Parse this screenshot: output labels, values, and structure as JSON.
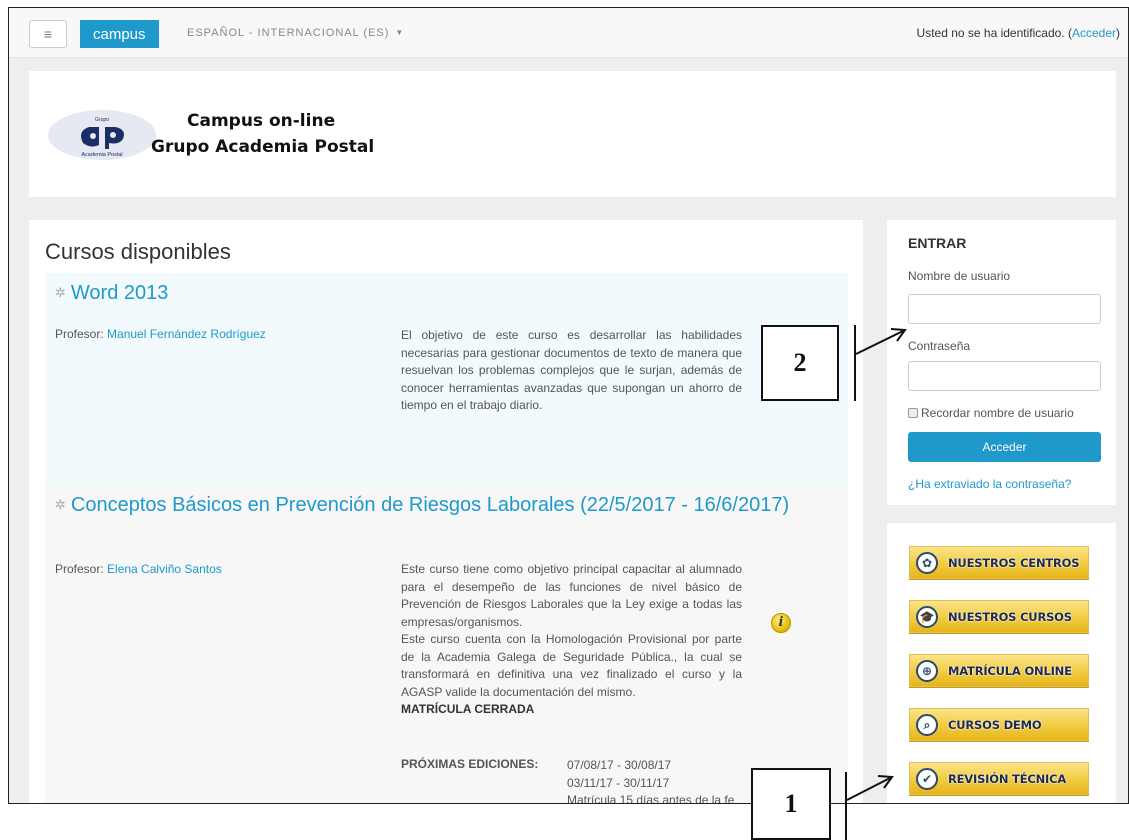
{
  "navbar": {
    "menu_icon": "hamburger-icon",
    "menu_glyph": "≡",
    "brand": "campus",
    "language": "ESPAÑOL - INTERNACIONAL (ES)",
    "login_status_prefix": "Usted no se ha identificado. (",
    "login_link": "Acceder",
    "login_status_suffix": ")"
  },
  "header": {
    "logo_icon": "academia-postal-logo",
    "logo_text_top": "Grupo",
    "logo_text_bottom": "Academia Postal",
    "site_line1": "Campus on-line",
    "site_line2": "Grupo Academia Postal"
  },
  "main": {
    "title": "Cursos disponibles",
    "courses": [
      {
        "title": "Word 2013",
        "teacher_label": "Profesor: ",
        "teacher_name": "Manuel Fernández Rodríguez",
        "summary": "El objetivo de este curso es desarrollar las habilidades necesarias para gestionar documentos de texto de manera que resuelvan los problemas complejos que le surjan, además de conocer herramientas avanzadas que supongan un ahorro de tiempo en el trabajo diario."
      },
      {
        "title": "Conceptos Básicos en Prevención de Riesgos Laborales (22/5/2017 - 16/6/2017)",
        "teacher_label": "Profesor: ",
        "teacher_name": "Elena Calviño Santos",
        "summary_p1": "Este curso tiene como objetivo principal capacitar al alumnado para el desempeño de las funciones de nivel básico de Prevención de Riesgos Laborales que la Ley exige a todas las empresas/organismos.",
        "summary_p2": "Este curso cuenta con la Homologación Provisional por parte de la  Academia Galega de Seguridade Pública., la cual se transformará en definitiva una vez finalizado el curso y la AGASP valide la documentación del mismo.",
        "closed": "MATRÍCULA CERRADA",
        "info_icon": "info-icon",
        "info_glyph": "i",
        "editions_label": "PRÓXIMAS EDICIONES:",
        "editions": [
          "07/08/17 - 30/08/17",
          "03/11/17 - 30/11/17",
          "Matrícula 15 días antes de la fe"
        ]
      }
    ]
  },
  "login": {
    "heading": "ENTRAR",
    "username_label": "Nombre de usuario",
    "username_value": "",
    "password_label": "Contraseña",
    "password_value": "",
    "remember_label": "Recordar nombre de usuario",
    "button": "Acceder",
    "forgot": "¿Ha extraviado la contraseña?"
  },
  "links": [
    {
      "label": "NUESTROS CENTROS",
      "icon": "map-icon",
      "glyph": "✿"
    },
    {
      "label": "NUESTROS CURSOS",
      "icon": "graduation-cap-icon",
      "glyph": "🎓"
    },
    {
      "label": "MATRÍCULA ONLINE",
      "icon": "globe-cursor-icon",
      "glyph": "⊕"
    },
    {
      "label": "CURSOS DEMO",
      "icon": "magnifier-icon",
      "glyph": "⌕"
    },
    {
      "label": "REVISIÓN TÉCNICA",
      "icon": "checkmark-globe-icon",
      "glyph": "✔"
    }
  ],
  "annotations": {
    "callout_1": "1",
    "callout_2": "2"
  },
  "colors": {
    "accent": "#1f99cc",
    "button_yellow": "#f2cb3f",
    "background": "#eeeeee"
  }
}
